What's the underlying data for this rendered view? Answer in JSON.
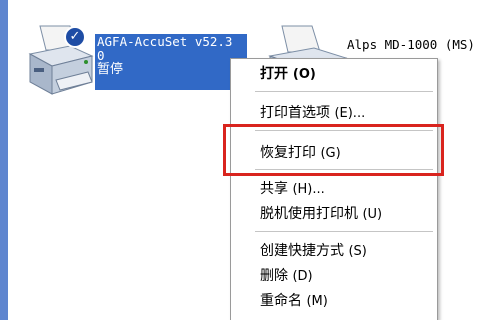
{
  "printers": [
    {
      "name": "AGFA-AccuSet v52.3\n0",
      "name_line1": "AGFA-AccuSet v52.3",
      "name_line2": "0",
      "status": "暂停",
      "default": true,
      "selected": true
    },
    {
      "name": "Alps MD-1000 (MS)",
      "selected": false
    }
  ],
  "context_menu": {
    "items": [
      {
        "label": "打开",
        "shortcut": "(O)",
        "default": true
      },
      {
        "label": "打印首选项",
        "shortcut": "(E)..."
      },
      {
        "label": "恢复打印",
        "shortcut": "(G)",
        "highlighted": true
      },
      {
        "label": "共享",
        "shortcut": "(H)..."
      },
      {
        "label": "脱机使用打印机",
        "shortcut": "(U)"
      },
      {
        "label": "创建快捷方式",
        "shortcut": "(S)"
      },
      {
        "label": "删除",
        "shortcut": "(D)"
      },
      {
        "label": "重命名",
        "shortcut": "(M)"
      }
    ]
  },
  "colors": {
    "selection": "#3169c6",
    "highlight_box": "#d9241e",
    "default_check": "#1f4da5",
    "left_strip": "#5f86cf"
  },
  "icons": {
    "printer": "printer-icon",
    "default_check": "checkmark-icon"
  }
}
